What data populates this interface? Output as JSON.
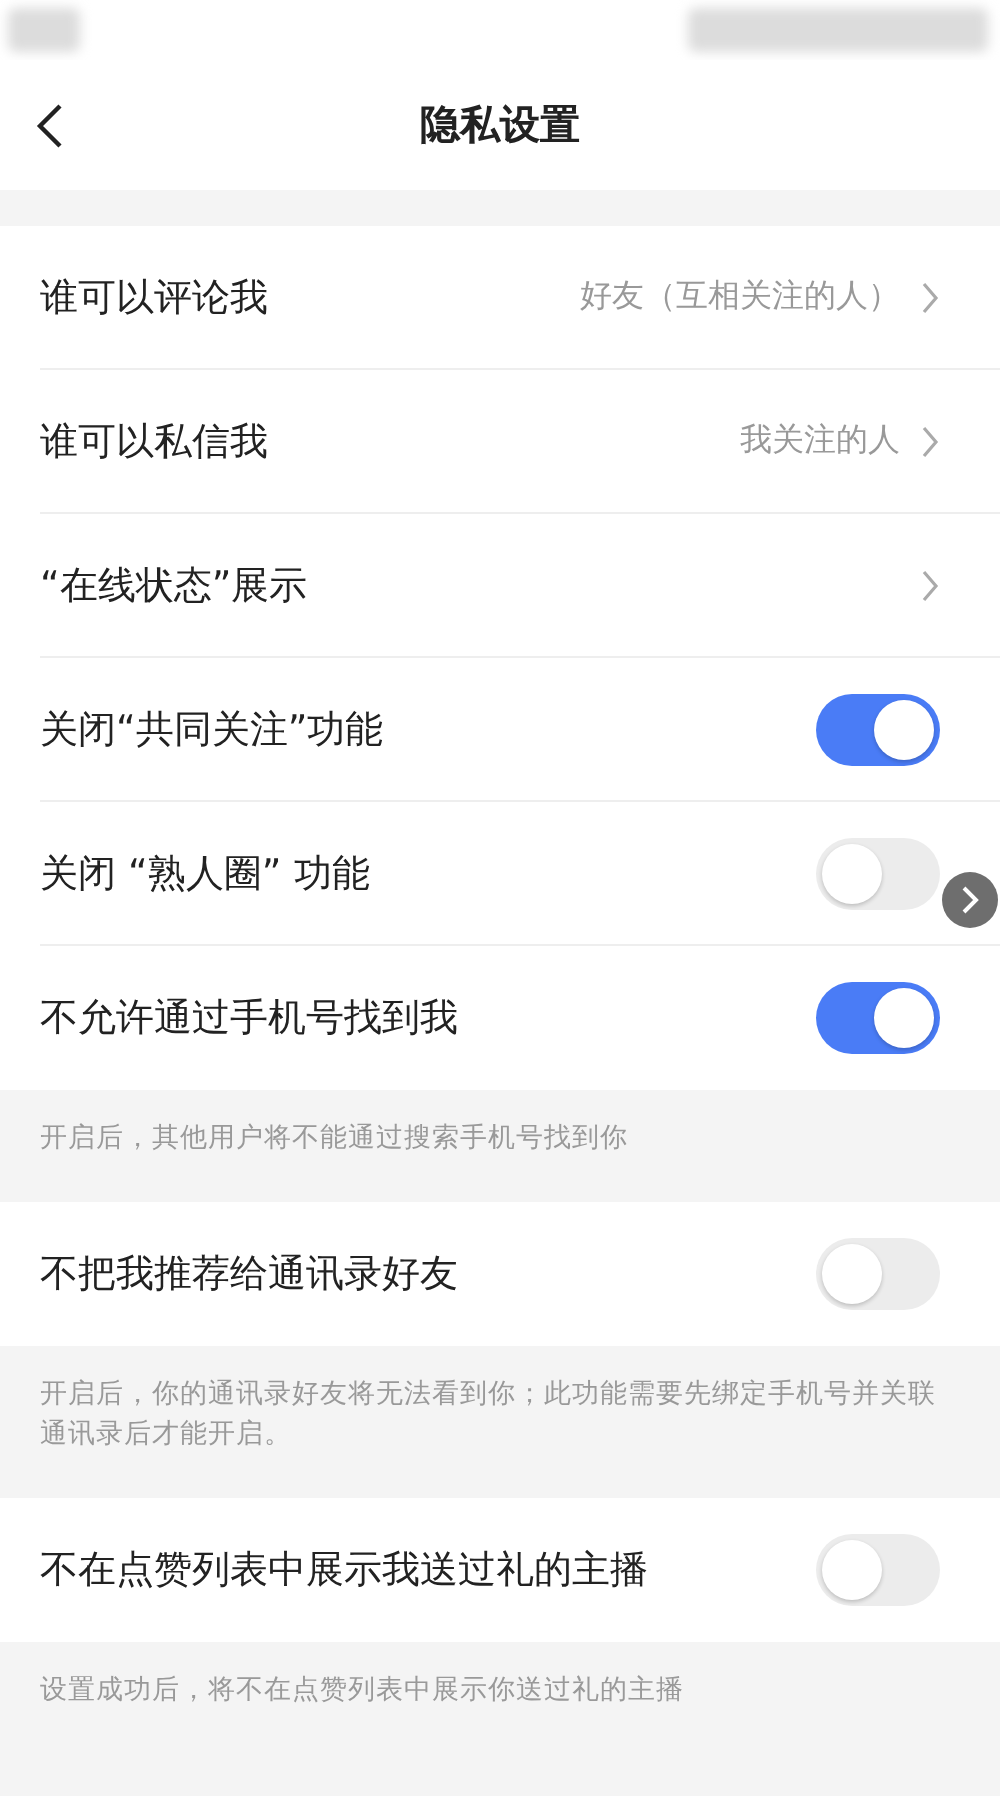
{
  "nav": {
    "title": "隐私设置"
  },
  "sections": [
    {
      "items": [
        {
          "kind": "link",
          "label": "谁可以评论我",
          "value": "好友（互相关注的人）"
        },
        {
          "kind": "link",
          "label": "谁可以私信我",
          "value": "我关注的人"
        },
        {
          "kind": "link",
          "label": "“在线状态”展示"
        },
        {
          "kind": "toggle",
          "label": "关闭“共同关注”功能",
          "on": true
        },
        {
          "kind": "toggle",
          "label": "关闭 “熟人圈” 功能",
          "on": false
        },
        {
          "kind": "toggle",
          "label": "不允许通过手机号找到我",
          "on": true
        }
      ],
      "note": "开启后，其他用户将不能通过搜索手机号找到你"
    },
    {
      "items": [
        {
          "kind": "toggle",
          "label": "不把我推荐给通讯录好友",
          "on": false
        }
      ],
      "note": "开启后，你的通讯录好友将无法看到你；此功能需要先绑定手机号并关联通讯录后才能开启。"
    },
    {
      "items": [
        {
          "kind": "toggle",
          "label": "不在点赞列表中展示我送过礼的主播",
          "on": false
        }
      ],
      "note": "设置成功后，将不在点赞列表中展示你送过礼的主播"
    }
  ]
}
